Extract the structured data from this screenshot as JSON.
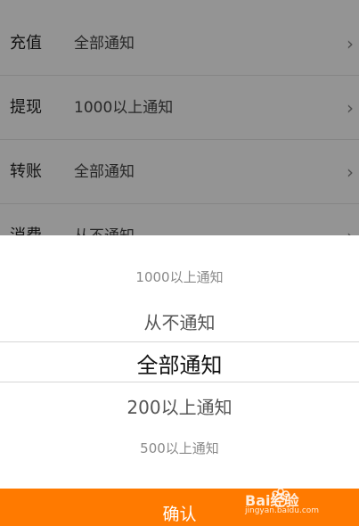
{
  "settings": {
    "rows": [
      {
        "label": "充值",
        "value": "全部通知"
      },
      {
        "label": "提现",
        "value": "1000以上通知"
      },
      {
        "label": "转账",
        "value": "全部通知"
      },
      {
        "label": "消费",
        "value": "从不通知"
      }
    ],
    "chevron_icon": "chevron-right-icon"
  },
  "picker": {
    "options": [
      "1000以上通知",
      "从不通知",
      "全部通知",
      "200以上通知",
      "500以上通知"
    ],
    "selected": "全部通知"
  },
  "confirm": {
    "label": "确认",
    "color": "#ff7a00"
  },
  "watermark": {
    "brand": "Bai经验",
    "url": "jingyan.baidu.com"
  }
}
